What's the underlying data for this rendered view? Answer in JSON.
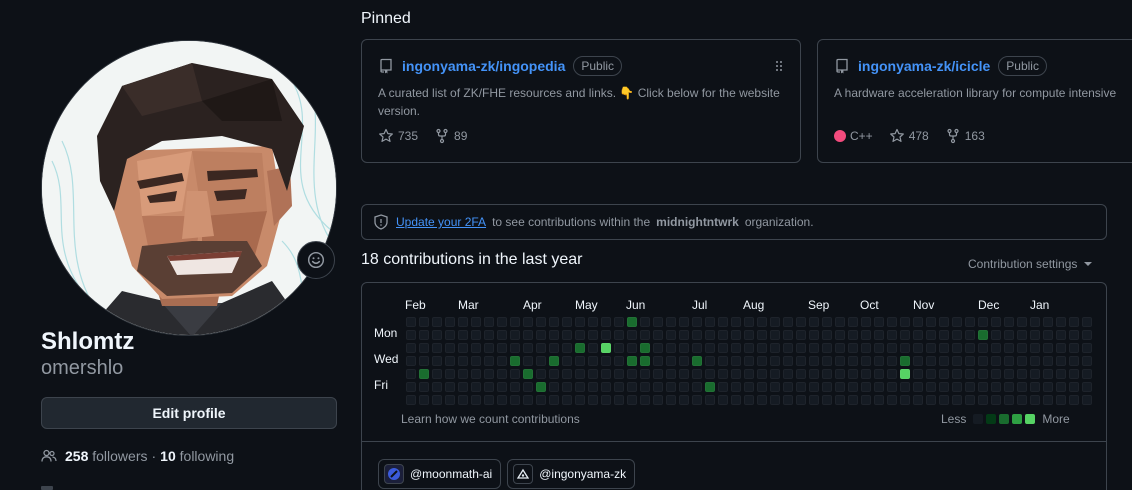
{
  "profile": {
    "display_name": "Shlomtz",
    "login": "omershlo",
    "edit_button": "Edit profile",
    "followers_count": "258",
    "followers_label": "followers",
    "separator": "·",
    "following_count": "10",
    "following_label": "following"
  },
  "pinned": {
    "title": "Pinned",
    "repos": [
      {
        "owner": "ingonyama-zk/",
        "name": "ingopedia",
        "visibility": "Public",
        "description": "A curated list of ZK/FHE resources and links. 👇 Click below for the website version.",
        "stars": "735",
        "forks": "89"
      },
      {
        "owner": "ingonyama-zk/",
        "name": "icicle",
        "visibility": "Public",
        "description": "A hardware acceleration library for compute intensive",
        "language": "C++",
        "language_color": "#f34b7d",
        "stars": "478",
        "forks": "163"
      }
    ]
  },
  "notice": {
    "link_text": "Update your 2FA",
    "text_before_org": "to see contributions within the",
    "org": "midnightntwrk",
    "text_after_org": "organization."
  },
  "contributions": {
    "title": "18 contributions in the last year",
    "settings_label": "Contribution settings",
    "months": [
      "Feb",
      "Mar",
      "Apr",
      "May",
      "Jun",
      "Jul",
      "Aug",
      "Sep",
      "Oct",
      "Nov",
      "Dec",
      "Jan"
    ],
    "day_labels": [
      "Mon",
      "Wed",
      "Fri"
    ],
    "learn_text": "Learn how we count contributions",
    "legend_less": "Less",
    "legend_more": "More",
    "level_colors": [
      "#151b23",
      "#033a16",
      "#196c2e",
      "#2ea043",
      "#56d364"
    ],
    "weeks": 53,
    "active_days": [
      {
        "week": 1,
        "day": 4,
        "level": 2
      },
      {
        "week": 8,
        "day": 3,
        "level": 2
      },
      {
        "week": 9,
        "day": 4,
        "level": 2
      },
      {
        "week": 10,
        "day": 5,
        "level": 2
      },
      {
        "week": 11,
        "day": 3,
        "level": 2
      },
      {
        "week": 13,
        "day": 2,
        "level": 2
      },
      {
        "week": 15,
        "day": 2,
        "level": 4
      },
      {
        "week": 17,
        "day": 0,
        "level": 2
      },
      {
        "week": 17,
        "day": 3,
        "level": 2
      },
      {
        "week": 18,
        "day": 2,
        "level": 2
      },
      {
        "week": 18,
        "day": 3,
        "level": 2
      },
      {
        "week": 22,
        "day": 3,
        "level": 2
      },
      {
        "week": 23,
        "day": 5,
        "level": 2
      },
      {
        "week": 38,
        "day": 3,
        "level": 2
      },
      {
        "week": 38,
        "day": 4,
        "level": 4
      },
      {
        "week": 44,
        "day": 1,
        "level": 2
      }
    ]
  },
  "organizations": [
    {
      "handle": "@moonmath-ai"
    },
    {
      "handle": "@ingonyama-zk"
    }
  ]
}
